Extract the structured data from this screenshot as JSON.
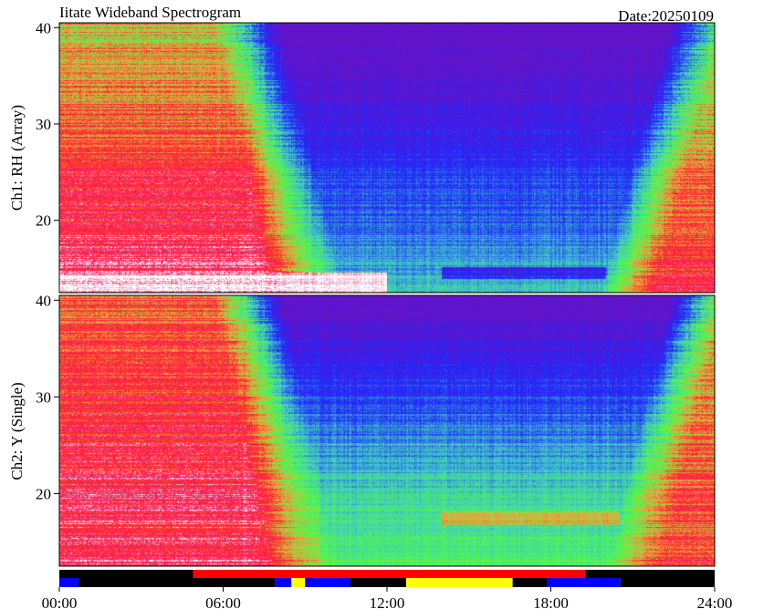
{
  "chart_data": {
    "type": "heatmap",
    "title": "Iitate Wideband Spectrogram",
    "date_label": "Date:20250109",
    "x_ticks": [
      "00:00",
      "06:00",
      "12:00",
      "18:00",
      "24:00"
    ],
    "x_range_hours": [
      0,
      24
    ],
    "panels": [
      {
        "ylabel": "Ch1: RH (Array)",
        "ylim": [
          12.5,
          40.5
        ],
        "y_ticks": [
          20,
          30,
          40
        ],
        "profile": "ch1"
      },
      {
        "ylabel": "Ch2: Y (Single)",
        "ylim": [
          12.5,
          40.5
        ],
        "y_ticks": [
          20,
          30,
          40
        ],
        "profile": "ch2"
      }
    ],
    "status_bar": {
      "row1": [
        {
          "start": 0.0,
          "end": 4.9,
          "color": "#000000"
        },
        {
          "start": 4.9,
          "end": 19.25,
          "color": "#ff0000"
        },
        {
          "start": 19.25,
          "end": 24.0,
          "color": "#000000"
        }
      ],
      "row2": [
        {
          "start": 0.0,
          "end": 0.7,
          "color": "#0000ff"
        },
        {
          "start": 0.7,
          "end": 7.9,
          "color": "#000000"
        },
        {
          "start": 7.9,
          "end": 8.5,
          "color": "#0000ff"
        },
        {
          "start": 8.5,
          "end": 9.0,
          "color": "#ffff00"
        },
        {
          "start": 9.0,
          "end": 10.65,
          "color": "#0000ff"
        },
        {
          "start": 10.65,
          "end": 12.7,
          "color": "#000000"
        },
        {
          "start": 12.7,
          "end": 16.6,
          "color": "#ffff00"
        },
        {
          "start": 16.6,
          "end": 17.85,
          "color": "#000000"
        },
        {
          "start": 17.85,
          "end": 20.55,
          "color": "#0000ff"
        },
        {
          "start": 20.55,
          "end": 24.0,
          "color": "#000000"
        }
      ]
    },
    "colors": {
      "white": "#ffffff",
      "magenta": "#ff1a66",
      "red": "#ff2828",
      "orange": "#f0a040",
      "green": "#50ff40",
      "cyan": "#40c8c8",
      "blue": "#1e28ff",
      "violet": "#6414c8"
    }
  }
}
